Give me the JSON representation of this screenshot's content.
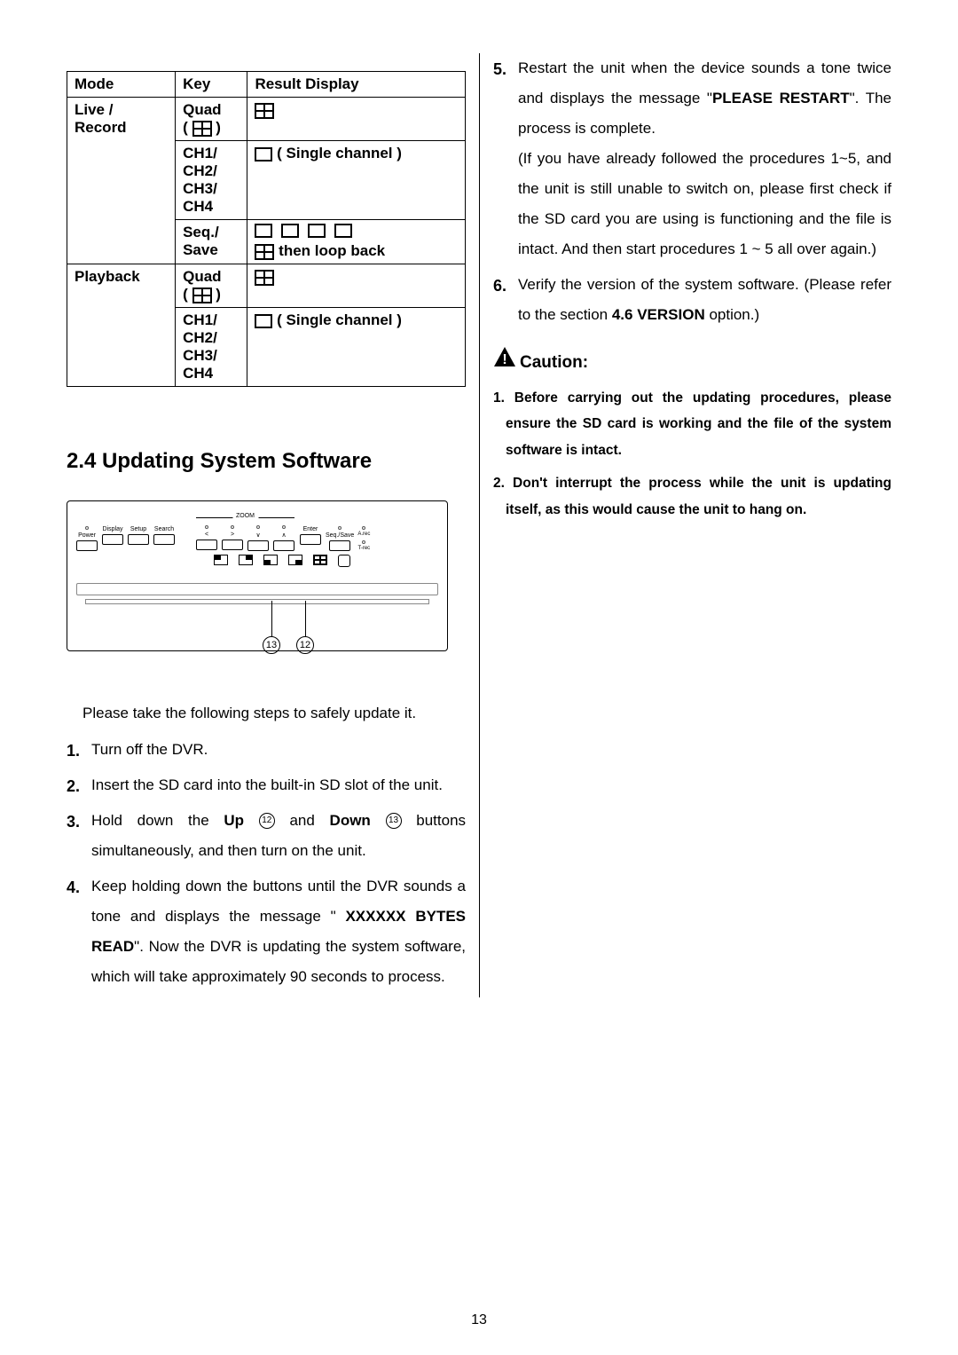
{
  "table": {
    "headers": {
      "mode": "Mode",
      "key": "Key",
      "result": "Result Display"
    },
    "rows": {
      "live": {
        "mode1": "Live /",
        "mode2": "Record",
        "quad": "Quad",
        "quad_paren_open": "(",
        "quad_paren_close": ")",
        "ch1": "CH1/",
        "ch2": "CH2/",
        "ch3": "CH3/",
        "ch4": "CH4",
        "single_label": "( Single channel )",
        "seq": "Seq./",
        "save": "Save",
        "loop": "then loop back"
      },
      "playback": {
        "mode": "Playback",
        "quad": "Quad",
        "paren_open": "(",
        "paren_close": ")",
        "ch1": "CH1/",
        "ch2": "CH2/",
        "ch3": "CH3/",
        "ch4": "CH4",
        "single_label": "( Single channel )"
      }
    }
  },
  "section_title": "2.4 Updating System Software",
  "panel": {
    "zoom": "ZOOM",
    "btns_left": [
      "Power",
      "Display",
      "Setup",
      "Search"
    ],
    "btns_zoom": [
      "<",
      ">",
      "∨",
      "∧"
    ],
    "btns_right": [
      "Enter",
      "Seq./Save"
    ],
    "leds_right": [
      {
        "t": "A.rec"
      },
      {
        "t": "T-rec"
      }
    ],
    "circ13": "13",
    "circ12": "12"
  },
  "steps": {
    "intro": "Please take the following steps to safely update it.",
    "s1": {
      "n": "1.",
      "t": "Turn off the DVR."
    },
    "s2": {
      "n": "2.",
      "t": "Insert the SD card into the built-in SD slot of the unit."
    },
    "s3": {
      "n": "3.",
      "pre": "Hold down the ",
      "up": "Up",
      "mid": " and ",
      "down": "Down",
      "post": " buttons simultaneously, and then turn on the unit.",
      "c12": "12",
      "c13": "13"
    },
    "s4": {
      "n": "4.",
      "pre": "Keep holding down the buttons until the DVR sounds a tone and displays the message \"  ",
      "bold1": "XXXXXX    BYTES READ",
      "post": "\". Now the DVR is updating the system software, which will take approximately 90 seconds to process."
    },
    "s5": {
      "n": "5.",
      "pre": "Restart the unit when the device sounds a tone twice and displays the message \"",
      "bold": "PLEASE RESTART",
      "post": "\". The process is complete.",
      "para2a": "(If you have already followed the procedures 1~5, and the unit is still unable to switch on, please first check if the SD card you are using is functioning and the file is intact. And then start procedures 1 ~ 5 all over again.)"
    },
    "s6": {
      "n": "6.",
      "pre": "Verify the version of the system software. (Please refer to the section ",
      "bold": "4.6 VERSION",
      "post": " option.)"
    }
  },
  "caution": {
    "label": "Caution:",
    "c1": "1. Before carrying out the updating procedures, please ensure the SD card is working and the file of the system software is intact.",
    "c2": "2. Don't interrupt the process while the unit is updating itself, as this would cause the unit to hang on."
  },
  "page": "13"
}
